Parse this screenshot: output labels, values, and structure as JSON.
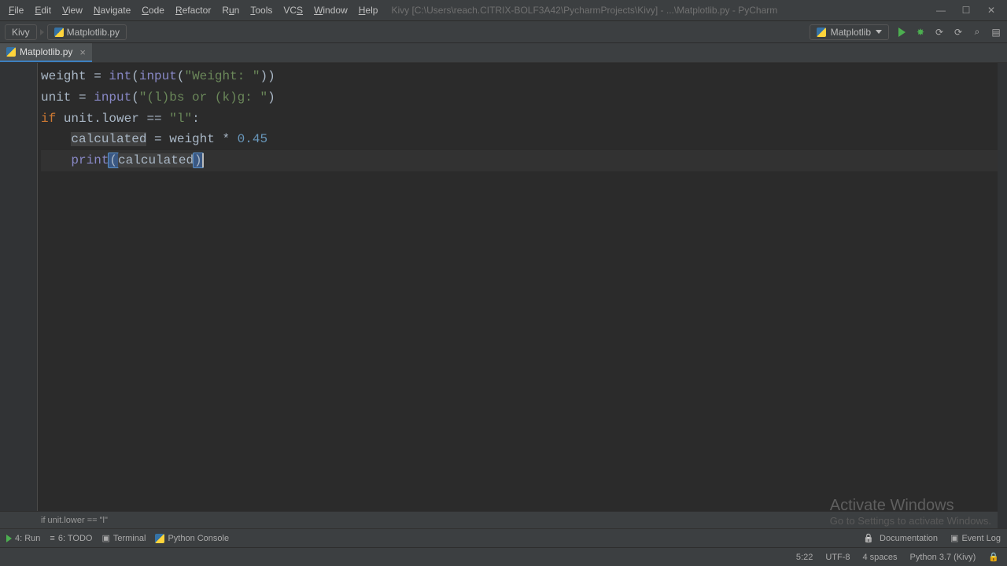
{
  "menu": [
    "File",
    "Edit",
    "View",
    "Navigate",
    "Code",
    "Refactor",
    "Run",
    "Tools",
    "VCS",
    "Window",
    "Help"
  ],
  "window_title": "Kivy [C:\\Users\\reach.CITRIX-BOLF3A42\\PycharmProjects\\Kivy] - ...\\Matplotlib.py - PyCharm",
  "breadcrumbs": {
    "project": "Kivy",
    "file": "Matplotlib.py"
  },
  "run_config_name": "Matplotlib",
  "tab_name": "Matplotlib.py",
  "code": {
    "l1": {
      "var": "weight",
      "eq": " = ",
      "fn": "int",
      "op": "(",
      "fn2": "input",
      "op2": "(",
      "str": "\"Weight: \"",
      "close": "))"
    },
    "l2": {
      "var": "unit",
      "eq": " = ",
      "fn": "input",
      "op": "(",
      "str": "\"(l)bs or (k)g: \"",
      "close": ")"
    },
    "l3": {
      "kw": "if",
      "sp": " ",
      "expr": "unit.lower",
      "sp2": " ",
      "cmp": "==",
      "sp3": " ",
      "str": "\"l\"",
      "colon": ":"
    },
    "l4": {
      "indent": "    ",
      "var": "calculated",
      "eq": " = ",
      "rhs": "weight",
      "sp": " ",
      "star": "*",
      "sp2": " ",
      "num": "0.45"
    },
    "l5": {
      "indent": "    ",
      "fn": "print",
      "op": "(",
      "arg": "calculated",
      "close": ")"
    }
  },
  "editor_breadcrumb": "if unit.lower == \"l\"",
  "tool_tabs": {
    "run": "4: Run",
    "todo": "6: TODO",
    "terminal": "Terminal",
    "console": "Python Console"
  },
  "status_right": {
    "doc": "Documentation",
    "eventlog": "Event Log"
  },
  "status": {
    "pos": "5:22",
    "enc": "UTF-8",
    "indent": "4 spaces",
    "interp": "Python 3.7 (Kivy)"
  },
  "watermark": {
    "t1": "Activate Windows",
    "t2": "Go to Settings to activate Windows."
  }
}
